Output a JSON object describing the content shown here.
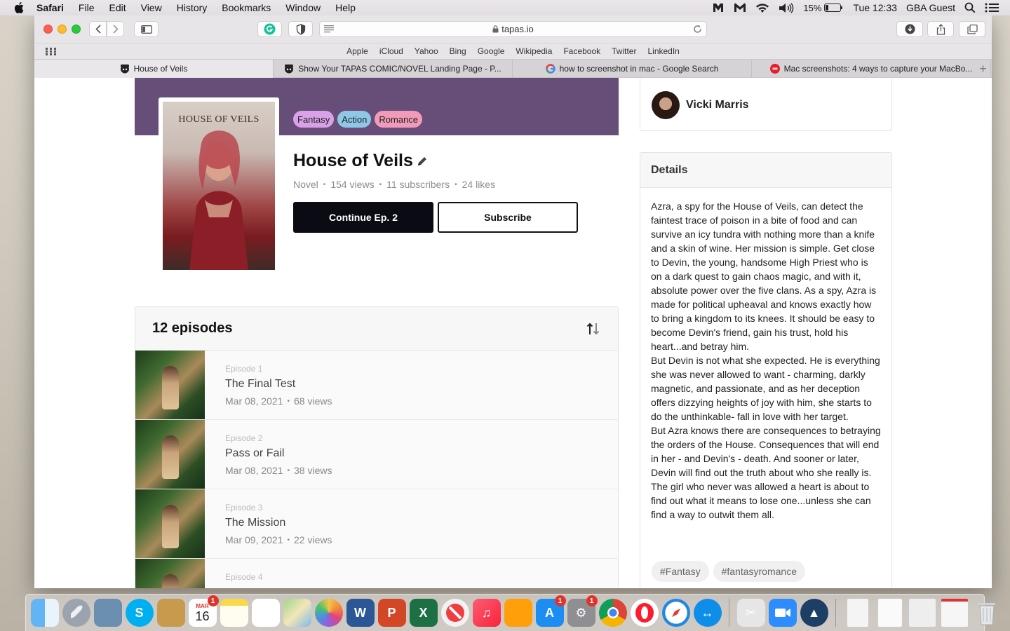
{
  "menubar": {
    "app": "Safari",
    "items": [
      "File",
      "Edit",
      "View",
      "History",
      "Bookmarks",
      "Window",
      "Help"
    ],
    "battery": "15%",
    "clock": "Tue 12:33",
    "user": "GBA Guest"
  },
  "browser": {
    "url": "tapas.io",
    "favorites": [
      "Apple",
      "iCloud",
      "Yahoo",
      "Bing",
      "Google",
      "Wikipedia",
      "Facebook",
      "Twitter",
      "LinkedIn"
    ],
    "tabs": [
      {
        "title": "House of Veils",
        "active": true
      },
      {
        "title": "Show Your TAPAS COMIC/NOVEL Landing Page - P...",
        "active": false
      },
      {
        "title": "how to screenshot in mac - Google Search",
        "active": false
      },
      {
        "title": "Mac screenshots: 4 ways to capture your MacBo...",
        "active": false
      }
    ]
  },
  "series": {
    "cover_title": "HOUSE OF VEILS",
    "genres": [
      {
        "label": "Fantasy",
        "color": "#d9a2e8"
      },
      {
        "label": "Action",
        "color": "#8ec8e6"
      },
      {
        "label": "Romance",
        "color": "#f29bb8"
      }
    ],
    "title": "House of Veils",
    "type": "Novel",
    "views": "154 views",
    "subscribers": "11 subscribers",
    "likes": "24 likes",
    "continue_label": "Continue Ep. 2",
    "subscribe_label": "Subscribe",
    "banner_color": "#664e78"
  },
  "episodes": {
    "count_label": "12 episodes",
    "items": [
      {
        "number": "Episode 1",
        "title": "The Final Test",
        "date": "Mar 08, 2021",
        "views": "68 views"
      },
      {
        "number": "Episode 2",
        "title": "Pass or Fail",
        "date": "Mar 08, 2021",
        "views": "38 views"
      },
      {
        "number": "Episode 3",
        "title": "The Mission",
        "date": "Mar 09, 2021",
        "views": "22 views"
      },
      {
        "number": "Episode 4",
        "title": "",
        "date": "",
        "views": ""
      }
    ]
  },
  "author": {
    "name": "Vicki Marris"
  },
  "details": {
    "heading": "Details",
    "paragraphs": [
      "Azra, a spy for the House of Veils, can detect the faintest trace of poison in a bite of food and can survive an icy tundra with nothing more than a knife and a skin of wine. Her mission is simple. Get close to Devin, the young, handsome High Priest who is on a dark quest to gain chaos magic, and with it, absolute power over the five clans. As a spy, Azra is made for political upheaval and knows exactly how to bring a kingdom to its knees. It should be easy to become Devin's friend, gain his trust, hold his heart...and betray him.",
      "But Devin is not what she expected. He is everything she was never allowed to want - charming, darkly magnetic, and passionate, and as her deception offers dizzying heights of joy with him, she starts to do the unthinkable- fall in love with her target.",
      "But Azra knows there are consequences to betraying the orders of the House. Consequences that will end in her - and Devin's - death. And sooner or later, Devin will find out the truth about who she really is.",
      "The girl who never was allowed a heart is about to find out what it means to lose one...unless she can find a way to outwit them all."
    ],
    "tags": [
      "#Fantasy",
      "#fantasyromance"
    ]
  },
  "dock": {
    "calendar_month": "MAR",
    "calendar_day": "16",
    "calendar_badge": "1",
    "appstore_badge": "1",
    "prefs_badge": "1",
    "icons": [
      "finder-icon",
      "launchpad-icon",
      "preview-icon",
      "skype-icon",
      "notes-folder-icon",
      "calendar-icon",
      "notes-icon",
      "reminders-icon",
      "maps-icon",
      "photos-icon",
      "word-icon",
      "powerpoint-icon",
      "excel-icon",
      "news-icon",
      "music-icon",
      "books-icon",
      "app-store-icon",
      "system-preferences-icon",
      "chrome-icon",
      "opera-icon",
      "safari-icon",
      "teamviewer-icon",
      "xcode-tools-icon",
      "zoom-icon",
      "sync-icon"
    ]
  }
}
